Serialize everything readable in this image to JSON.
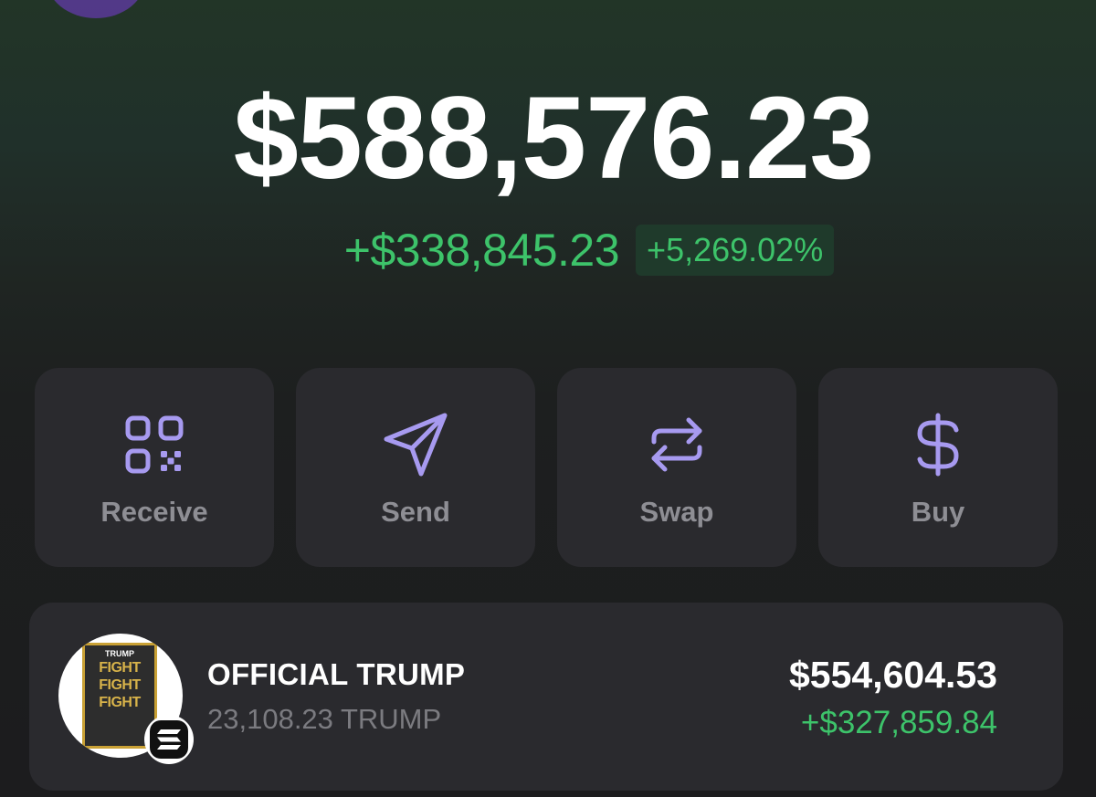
{
  "portfolio": {
    "balance": "$588,576.23",
    "change_amount": "+$338,845.23",
    "change_percent": "+5,269.02%"
  },
  "actions": [
    {
      "label": "Receive",
      "icon": "qr-code-icon"
    },
    {
      "label": "Send",
      "icon": "send-arrow-icon"
    },
    {
      "label": "Swap",
      "icon": "swap-arrows-icon"
    },
    {
      "label": "Buy",
      "icon": "dollar-icon"
    }
  ],
  "tokens": [
    {
      "name": "OFFICIAL TRUMP",
      "quantity": "23,108.23 TRUMP",
      "value": "$554,604.53",
      "change": "+$327,859.84",
      "avatar_text_top": "TRUMP",
      "avatar_text_fight": [
        "FIGHT",
        "FIGHT",
        "FIGHT"
      ],
      "chain_icon": "solana-icon"
    }
  ],
  "colors": {
    "accent_purple": "#a79af0",
    "positive_green": "#3dc36a",
    "card_bg": "#2a2a2e",
    "page_bg": "#1c1c1e"
  }
}
